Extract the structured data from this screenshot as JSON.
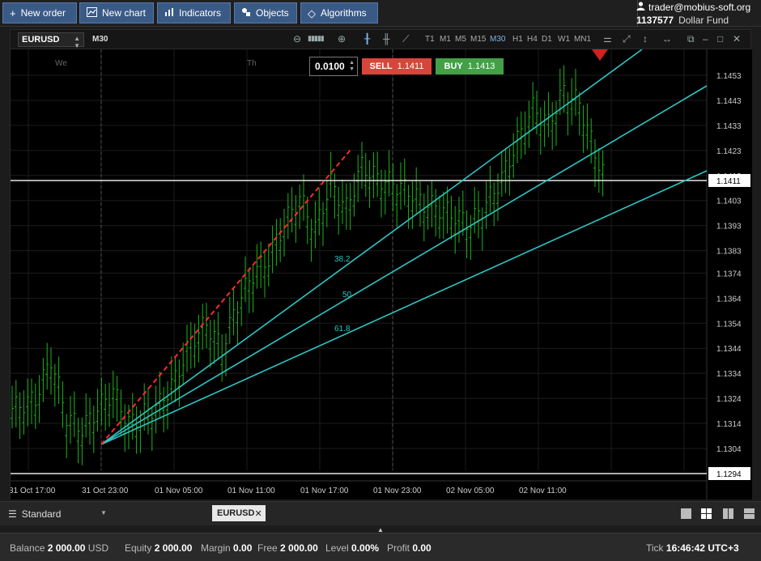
{
  "toolbar": {
    "new_order": "New order",
    "new_chart": "New chart",
    "indicators": "Indicators",
    "objects": "Objects",
    "algorithms": "Algorithms"
  },
  "account": {
    "email": "trader@mobius-soft.org",
    "number": "1137577",
    "name": "Dollar Fund"
  },
  "chart": {
    "symbol": "EURUSD",
    "timeframe": "M30",
    "timeframes": [
      "T1",
      "M1",
      "M5",
      "M15",
      "M30",
      "H1",
      "H4",
      "D1",
      "W1",
      "MN1"
    ],
    "active_timeframe": "M30",
    "day_labels": [
      "We",
      "Th"
    ],
    "lot": "0.0100",
    "sell_label": "SELL",
    "sell_price": "1.1411",
    "buy_label": "BUY",
    "buy_price": "1.1413",
    "price_axis": [
      "1.1453",
      "1.1443",
      "1.1433",
      "1.1423",
      "1.1413",
      "1.1403",
      "1.1393",
      "1.1383",
      "1.1374",
      "1.1364",
      "1.1354",
      "1.1344",
      "1.1334",
      "1.1324",
      "1.1314",
      "1.1304"
    ],
    "current_price": "1.1411",
    "low_line_price": "1.1294",
    "time_axis": [
      "31 Oct 17:00",
      "31 Oct 23:00",
      "01 Nov 05:00",
      "01 Nov 11:00",
      "01 Nov 17:00",
      "01 Nov 23:00",
      "02 Nov 05:00",
      "02 Nov 11:00"
    ],
    "fib_levels": [
      "38.2",
      "50",
      "61.8"
    ],
    "colors": {
      "fan": "#2ec4c4",
      "trend": "#ff2a2a",
      "bars": "#1db41d",
      "sell": "#d8453b",
      "buy": "#43a047"
    }
  },
  "tabs": {
    "layout": "Standard",
    "symbol_tab": "EURUSD"
  },
  "status": {
    "balance_label": "Balance",
    "balance_value": "2 000.00",
    "balance_currency": "USD",
    "equity_label": "Equity",
    "equity_value": "2 000.00",
    "margin_label": "Margin",
    "margin_value": "0.00",
    "free_label": "Free",
    "free_value": "2 000.00",
    "level_label": "Level",
    "level_value": "0.00%",
    "profit_label": "Profit",
    "profit_value": "0.00",
    "tick_label": "Tick",
    "tick_time": "16:46:42",
    "timezone": "UTC+3"
  }
}
